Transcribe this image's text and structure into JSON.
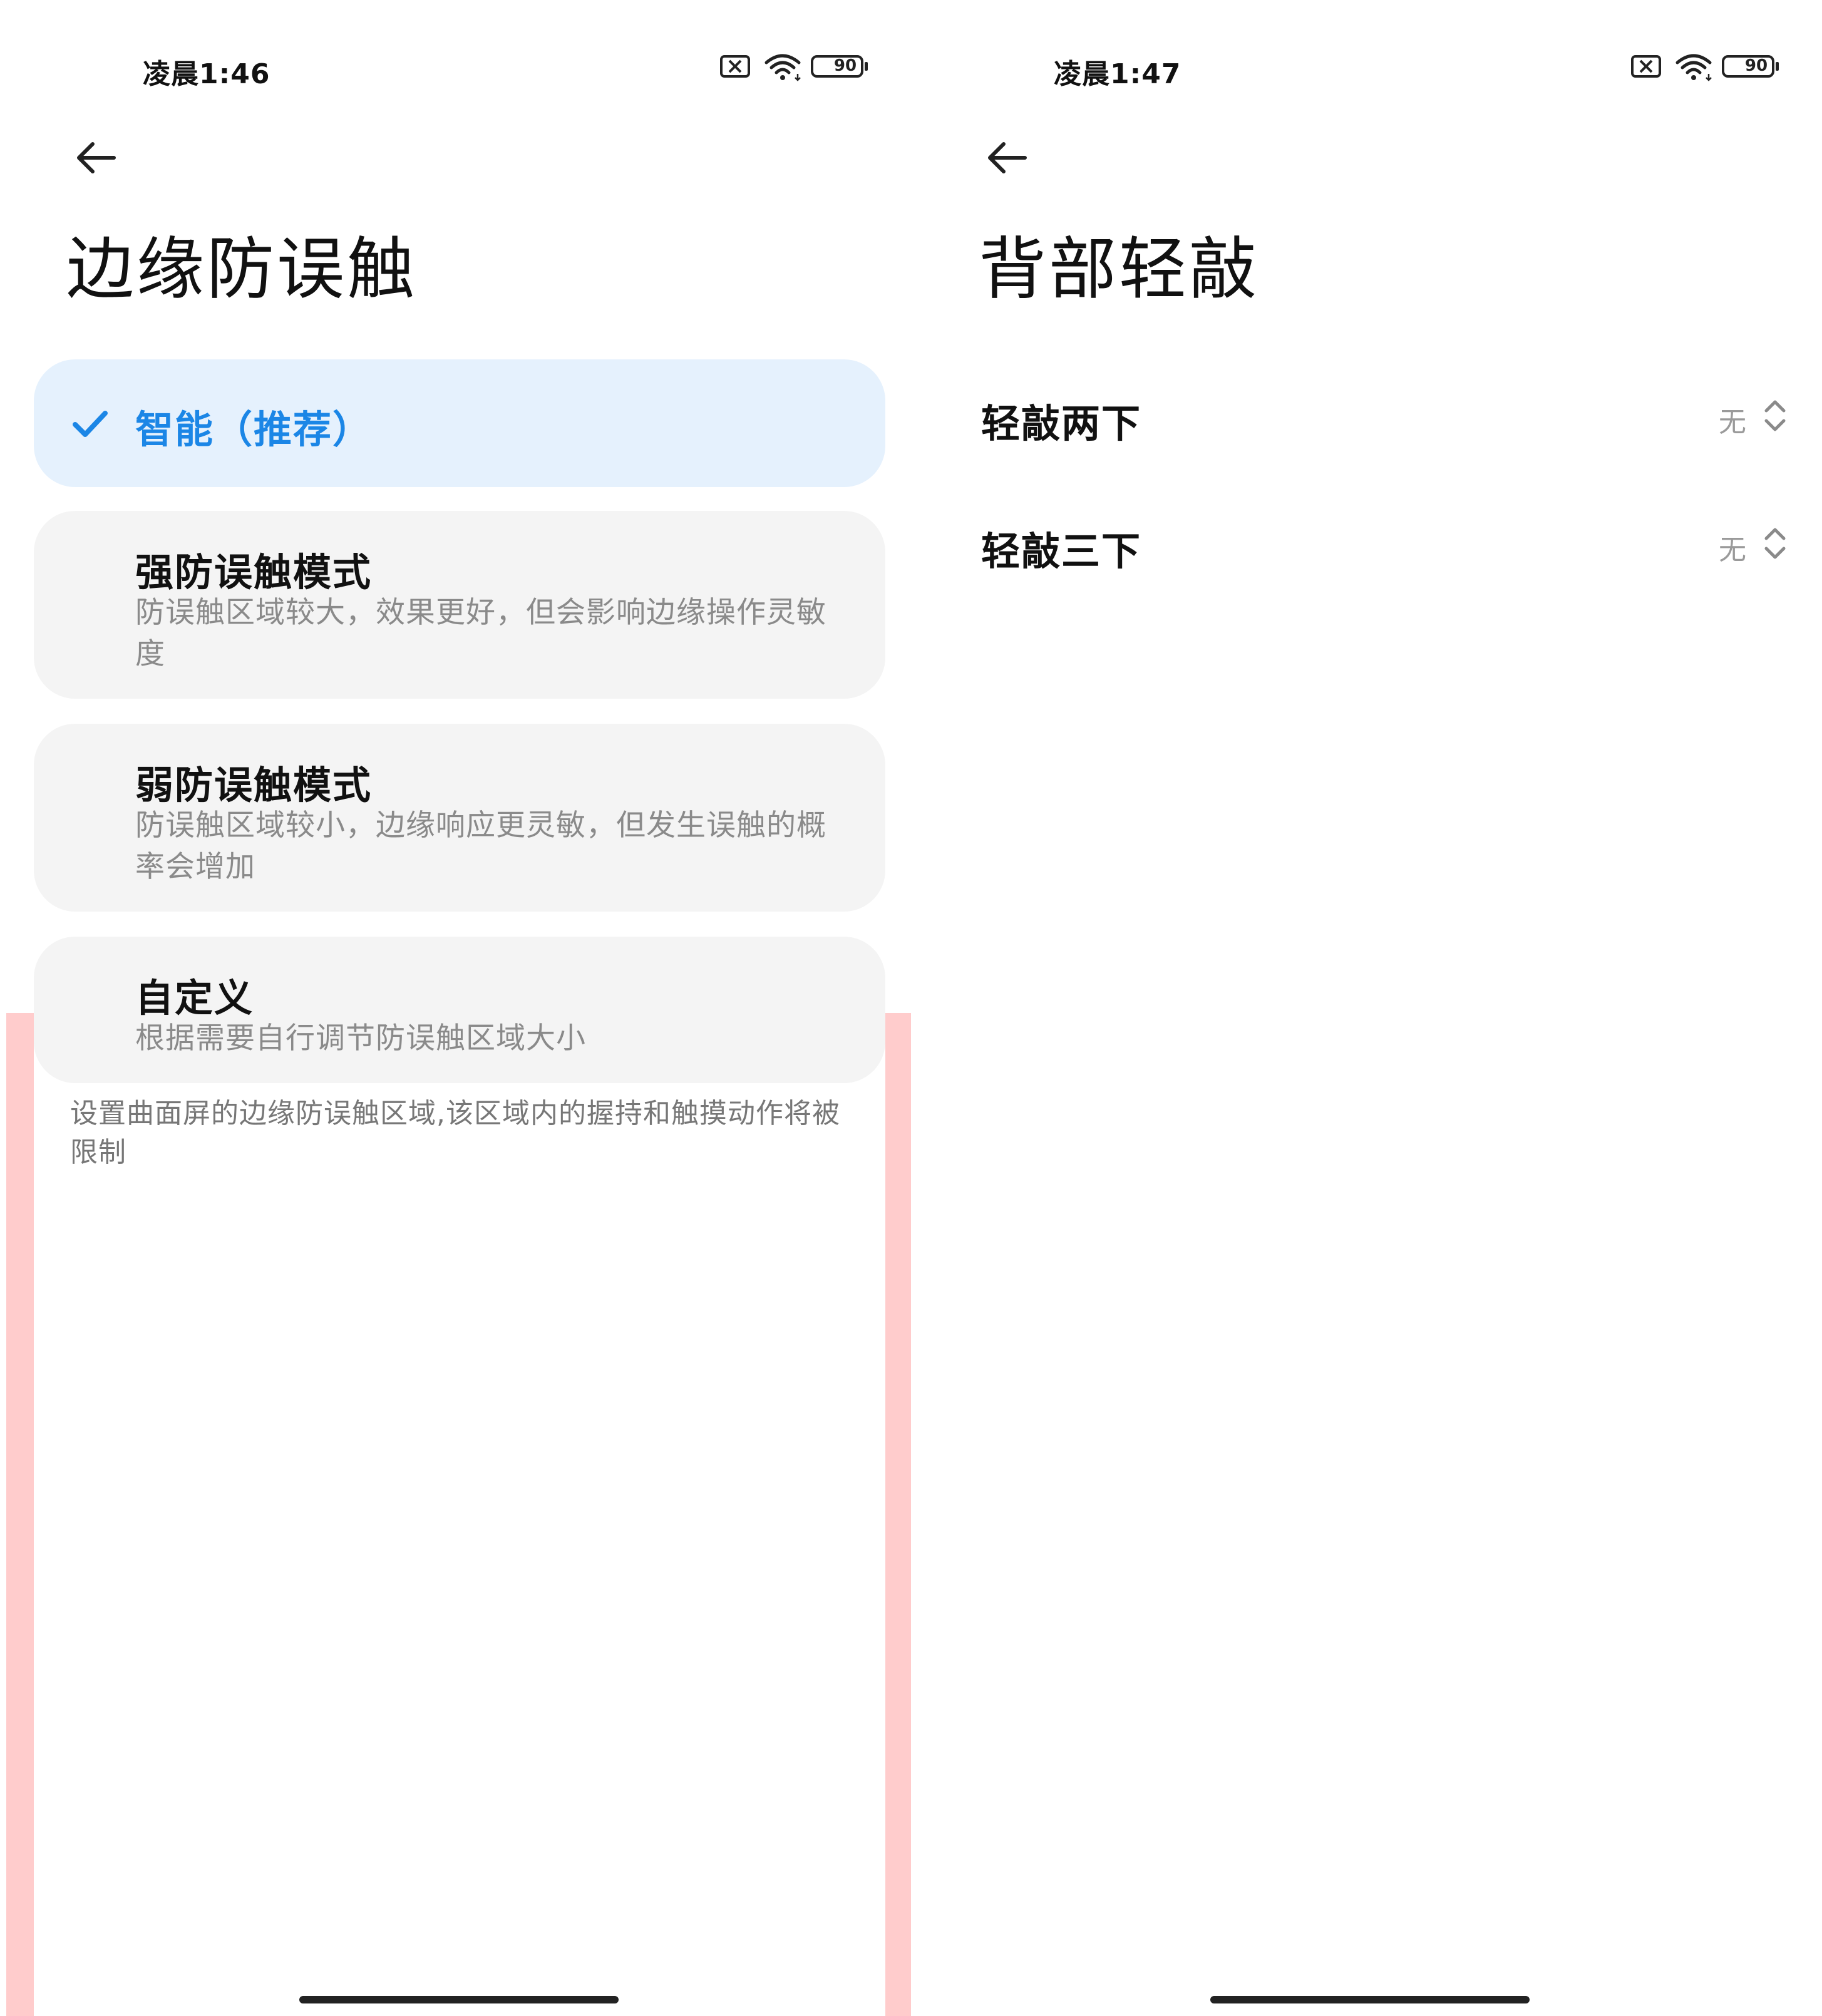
{
  "left": {
    "status": {
      "time": "凌晨1:46",
      "battery": "90"
    },
    "title": "边缘防误触",
    "options": [
      {
        "title": "智能（推荐）",
        "desc": "",
        "selected": true
      },
      {
        "title": "强防误触模式",
        "desc": "防误触区域较大，效果更好，但会影响边缘操作灵敏度",
        "selected": false
      },
      {
        "title": "弱防误触模式",
        "desc": "防误触区域较小，边缘响应更灵敏，但发生误触的概率会增加",
        "selected": false
      },
      {
        "title": "自定义",
        "desc": "根据需要自行调节防误触区域大小",
        "selected": false
      }
    ],
    "footnote": "设置曲面屏的边缘防误触区域,该区域内的握持和触摸动作将被限制"
  },
  "right": {
    "status": {
      "time": "凌晨1:47",
      "battery": "90"
    },
    "title": "背部轻敲",
    "items": [
      {
        "label": "轻敲两下",
        "value": "无"
      },
      {
        "label": "轻敲三下",
        "value": "无"
      }
    ]
  },
  "colors": {
    "accent": "#1b86e6",
    "selected_bg": "#e5f1fd",
    "card_bg": "#f4f4f4",
    "edge_highlight": "#ffcccc"
  },
  "icons": [
    "back-arrow-icon",
    "checkmark-icon",
    "sim-off-icon",
    "wifi-icon",
    "battery-icon",
    "chevron-up-down-icon"
  ]
}
